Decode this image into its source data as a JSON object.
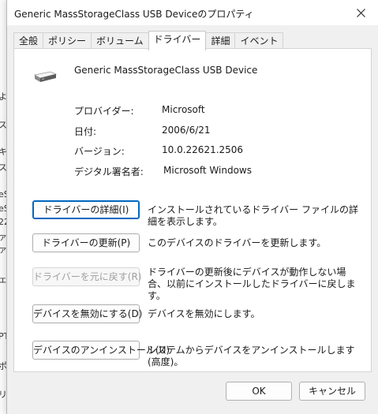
{
  "window": {
    "title": "Generic MassStorageClass USB Deviceのプロパティ",
    "close_glyph": "✕"
  },
  "tabs": [
    {
      "label": "全般"
    },
    {
      "label": "ポリシー"
    },
    {
      "label": "ボリューム"
    },
    {
      "label": "ドライバー",
      "active": true
    },
    {
      "label": "詳細"
    },
    {
      "label": "イベント"
    }
  ],
  "device": {
    "icon": "usb-drive-icon",
    "name": "Generic MassStorageClass USB Device"
  },
  "properties": [
    {
      "label": "プロバイダー:",
      "value": "Microsoft"
    },
    {
      "label": "日付:",
      "value": "2006/6/21"
    },
    {
      "label": "バージョン:",
      "value": "10.0.22621.2506"
    },
    {
      "label": "デジタル署名者:",
      "value": "Microsoft Windows"
    }
  ],
  "actions": [
    {
      "button": "ドライバーの詳細(I)",
      "description": "インストールされているドライバー ファイルの詳細を表示します。",
      "enabled": true
    },
    {
      "button": "ドライバーの更新(P)",
      "description": "このデバイスのドライバーを更新します。",
      "enabled": true
    },
    {
      "button": "ドライバーを元に戻す(R)",
      "description": "ドライバーの更新後にデバイスが動作しない場合、以前にインストールしたドライバーに戻します。",
      "enabled": false
    },
    {
      "button": "デバイスを無効にする(D)",
      "description": "デバイスを無効にします。",
      "enabled": true
    },
    {
      "button": "デバイスのアンインストール(U)",
      "description": "システムからデバイスをアンインストールします (高度)。",
      "enabled": true
    }
  ],
  "footer": {
    "ok_label": "OK",
    "cancel_label": "キャンセル"
  },
  "background": {
    "fragments": [
      "よ",
      "ス",
      "キ",
      "ス",
      "eS",
      "eS",
      "22",
      "ァ",
      "ァ",
      "ェ",
      "PT",
      "ポ",
      "リ"
    ]
  }
}
